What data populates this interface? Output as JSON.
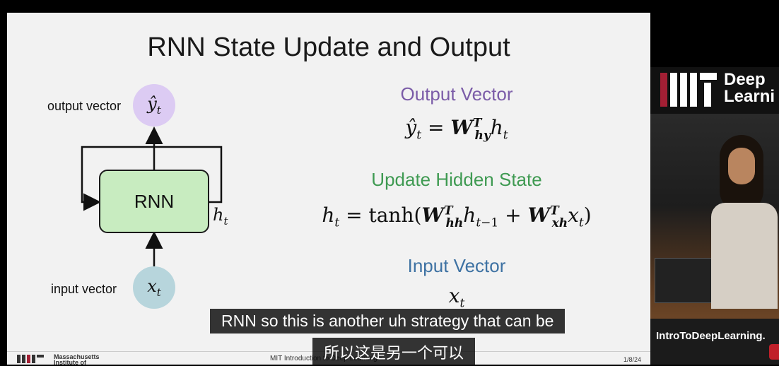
{
  "slide": {
    "title": "RNN State Update and Output",
    "output_label": "output vector",
    "input_label": "input vector",
    "rnn_label": "RNN",
    "output_heading": "Output Vector",
    "update_heading": "Update Hidden State",
    "input_heading": "Input Vector",
    "colors": {
      "output": "#7b5ca8",
      "update": "#3f9a52",
      "input": "#3e72a3",
      "output_circle": "#dccbf3",
      "input_circle": "#b7d5dc",
      "rnn_box": "#c8ecc0"
    },
    "footer": {
      "institute_line1": "Massachusetts",
      "institute_line2": "Institute of",
      "course": "MIT Introduction to Deep Learning",
      "page": "1/8/24"
    }
  },
  "side_video": {
    "brand": "Deep Learning",
    "brand_line1": "Deep",
    "brand_line2": "Learni",
    "url": "IntroToDeepLearning."
  },
  "subtitles": {
    "english": "RNN so this is another uh strategy that can be",
    "chinese": "所以这是另一个可以"
  }
}
